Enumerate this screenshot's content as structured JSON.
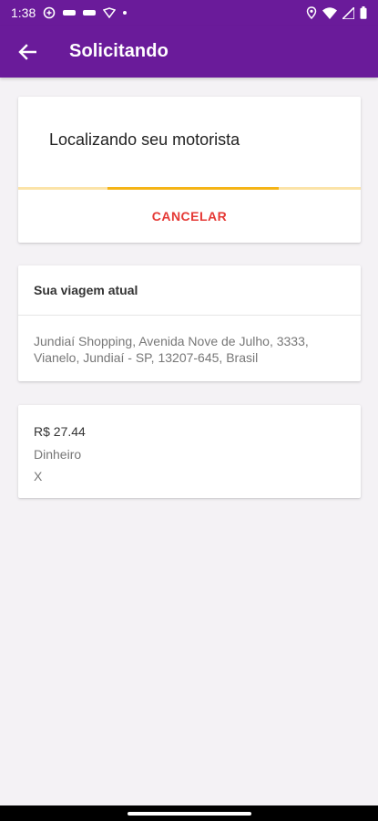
{
  "status_bar": {
    "time": "1:38",
    "left_icons": [
      "app-notification-icon",
      "minus-pill-icon",
      "minus-pill-icon",
      "shield-icon",
      "dot-icon"
    ],
    "right_icons": [
      "location-pin-icon",
      "wifi-icon",
      "signal-icon",
      "battery-icon"
    ]
  },
  "app_bar": {
    "title": "Solicitando",
    "back_icon": "arrow-back-icon",
    "background": "#6a1b9a"
  },
  "search_card": {
    "message": "Localizando seu motorista",
    "progress": {
      "start": 0.26,
      "end": 0.76,
      "track_color": "#fbe3a8",
      "fill_color": "#f5b416"
    },
    "cancel_label": "CANCELAR",
    "cancel_color": "#e53935"
  },
  "trip_card": {
    "header": "Sua viagem atual",
    "address": "Jundiaí Shopping, Avenida Nove de Julho, 3333, Vianelo, Jundiaí - SP, 13207-645, Brasil"
  },
  "payment_card": {
    "price": "R$ 27.44",
    "method": "Dinheiro",
    "extra": "X"
  }
}
